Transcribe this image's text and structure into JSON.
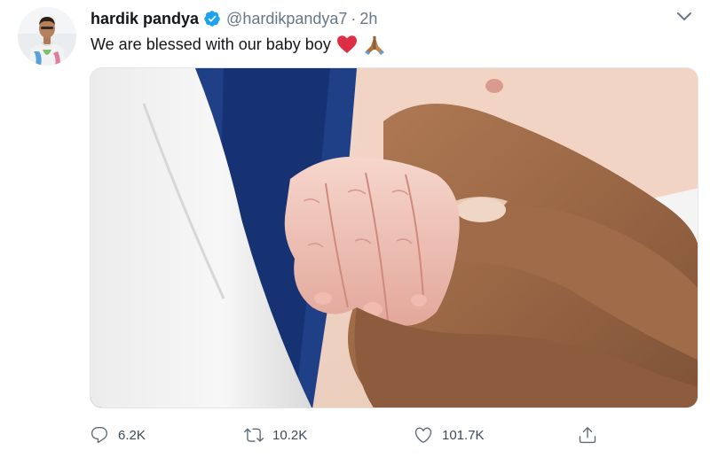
{
  "user": {
    "display_name": "hardik pandya",
    "handle": "@hardikpandya7",
    "separator": "·",
    "time": "2h",
    "verified": true
  },
  "tweet": {
    "text": "We are blessed with our baby boy",
    "emojis": [
      "red-heart",
      "folded-hands"
    ]
  },
  "stats": {
    "replies": "6.2K",
    "retweets": "10.2K",
    "likes": "101.7K"
  },
  "icons": {
    "reply": "reply-icon",
    "retweet": "retweet-icon",
    "like": "heart-icon",
    "share": "share-icon",
    "more": "chevron-down-icon"
  },
  "colors": {
    "verified": "#1da1f2",
    "heart_emoji": "#dd2e44",
    "secondary_text": "#657786"
  }
}
